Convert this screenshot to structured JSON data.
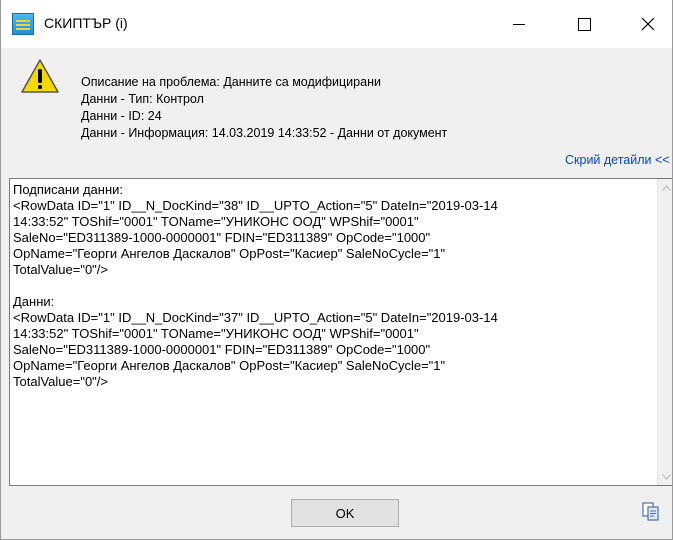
{
  "window": {
    "title": "СКИПТЪР (i)"
  },
  "info": {
    "description": "Описание на проблема: Данните са модифицирани",
    "type": "Данни - Тип: Контрол",
    "id": "Данни - ID: 24",
    "information": "Данни - Информация: 14.03.2019 14:33:52 - Данни от документ",
    "details_link": "Скрий детайли <<"
  },
  "details": {
    "text": "Подписани данни:\n<RowData ID=\"1\" ID__N_DocKind=\"38\" ID__UPTO_Action=\"5\" DateIn=\"2019-03-14\n14:33:52\" TOShif=\"0001\" TOName=\"УНИКОНС ООД\" WPShif=\"0001\"\nSaleNo=\"ED311389-1000-0000001\" FDIN=\"ED311389\" OpCode=\"1000\"\nOpName=\"Георги Ангелов Даскалов\" OpPost=\"Касиер\" SaleNoCycle=\"1\"\nTotalValue=\"0\"/>\n\nДанни:\n<RowData ID=\"1\" ID__N_DocKind=\"37\" ID__UPTO_Action=\"5\" DateIn=\"2019-03-14\n14:33:52\" TOShif=\"0001\" TOName=\"УНИКОНС ООД\" WPShif=\"0001\"\nSaleNo=\"ED311389-1000-0000001\" FDIN=\"ED311389\" OpCode=\"1000\"\nOpName=\"Георги Ангелов Даскалов\" OpPost=\"Касиер\" SaleNoCycle=\"1\"\nTotalValue=\"0\"/>"
  },
  "buttons": {
    "ok_label": "OK"
  },
  "icons": {
    "app": "app-icon",
    "warning": "warning-icon",
    "minimize": "minimize-icon",
    "maximize": "maximize-icon",
    "close": "close-icon",
    "copy": "copy-icon"
  },
  "colors": {
    "link": "#0645d6",
    "warning_fill": "#f5d800"
  }
}
